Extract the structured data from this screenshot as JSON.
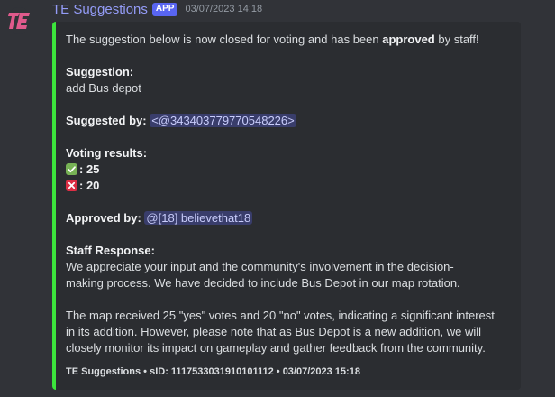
{
  "message": {
    "username": "TE Suggestions",
    "badge": "APP",
    "timestamp": "03/07/2023 14:18"
  },
  "embed": {
    "accent_color": "#3ce43c",
    "intro_before": "The suggestion below is now closed for voting and has been ",
    "intro_bold": "approved",
    "intro_after": " by staff!",
    "suggestion_label": "Suggestion:",
    "suggestion_value": "add Bus depot",
    "suggested_by_label": "Suggested by:",
    "suggested_by_mention": "<@343403779770548226>",
    "voting_label": "Voting results:",
    "votes_yes_icon": "check-mark-emoji",
    "votes_yes": ": 25",
    "votes_no_icon": "cross-mark-emoji",
    "votes_no": ": 20",
    "approved_by_label": "Approved by:",
    "approved_by_mention": "@[18] believethat18",
    "staff_response_label": "Staff Response:",
    "staff_response_p1_l1": "We appreciate your input and the community's involvement in the decision-",
    "staff_response_p1_l2": "making process. We have decided to include Bus Depot in our map rotation.",
    "staff_response_p2_l1": "The map received 25 \"yes\" votes and 20 \"no\" votes, indicating a significant interest",
    "staff_response_p2_l2": "in its addition. However, please note that as Bus Depot is a new addition, we will",
    "staff_response_p2_l3": "closely monitor its impact on gameplay and gather feedback from the community.",
    "footer": "TE Suggestions • sID: 1117533031910101112 • 03/07/2023 15:18"
  }
}
